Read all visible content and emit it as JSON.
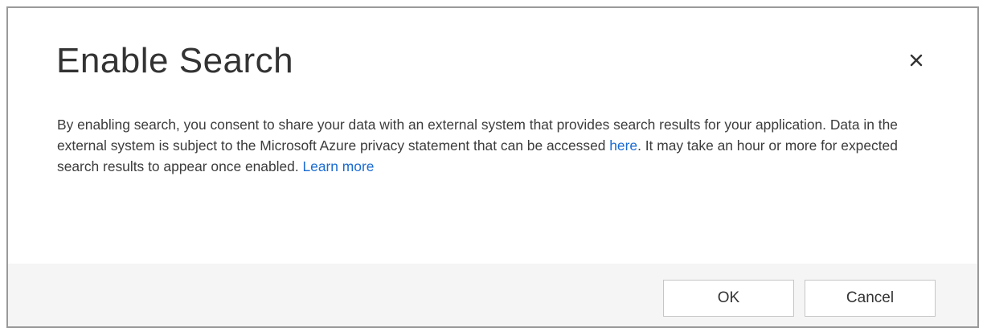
{
  "dialog": {
    "title": "Enable Search",
    "close_icon": "close-icon",
    "message": {
      "part1": "By enabling search, you consent to share your data with an external system that provides search results for your application. Data in the external system is subject to the Microsoft Azure privacy statement that can be accessed ",
      "link_here": "here",
      "part2": ". It may take an hour or more for expected search results to appear once enabled. ",
      "link_learn_more": "Learn more"
    },
    "buttons": {
      "ok": "OK",
      "cancel": "Cancel"
    }
  },
  "colors": {
    "link": "#1a6bd1",
    "footer_bg": "#f5f5f5",
    "title_text": "#333333"
  }
}
